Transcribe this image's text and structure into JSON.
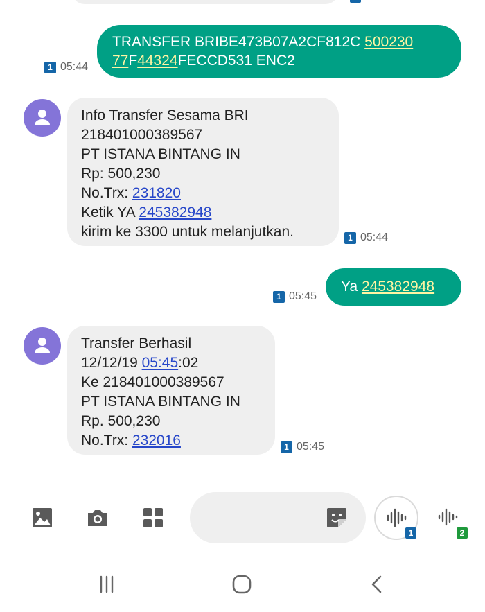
{
  "messages": [
    {
      "direction": "outgoing",
      "time": "05:44",
      "sim": "1",
      "lines": [
        [
          {
            "text": "TRANSFER BRIBE473B07A2CF812C "
          },
          {
            "text": "500230",
            "link": true
          }
        ],
        [
          {
            "text": "77",
            "link": true
          },
          {
            "text": "F"
          },
          {
            "text": "44324",
            "link": true
          },
          {
            "text": "FECCD531 ENC2"
          }
        ]
      ]
    },
    {
      "direction": "incoming",
      "time": "05:44",
      "sim": "1",
      "lines": [
        [
          {
            "text": "Info Transfer Sesama BRI"
          }
        ],
        [
          {
            "text": "218401000389567"
          }
        ],
        [
          {
            "text": "PT ISTANA BINTANG IN"
          }
        ],
        [
          {
            "text": "Rp: 500,230"
          }
        ],
        [
          {
            "text": "No.Trx: "
          },
          {
            "text": "231820",
            "link": true
          }
        ],
        [
          {
            "text": "Ketik YA "
          },
          {
            "text": "245382948",
            "link": true
          }
        ],
        [
          {
            "text": "kirim ke 3300 untuk melanjutkan."
          }
        ]
      ]
    },
    {
      "direction": "outgoing",
      "time": "05:45",
      "sim": "1",
      "lines": [
        [
          {
            "text": "Ya "
          },
          {
            "text": "245382948",
            "link": true
          }
        ]
      ]
    },
    {
      "direction": "incoming",
      "time": "05:45",
      "sim": "1",
      "lines": [
        [
          {
            "text": "Transfer Berhasil"
          }
        ],
        [
          {
            "text": "12/12/19 "
          },
          {
            "text": "05:45",
            "link": true
          },
          {
            "text": ":02"
          }
        ],
        [
          {
            "text": "Ke 218401000389567"
          }
        ],
        [
          {
            "text": "PT ISTANA BINTANG IN"
          }
        ],
        [
          {
            "text": "Rp. 500,230"
          }
        ],
        [
          {
            "text": "No.Trx: "
          },
          {
            "text": "232016",
            "link": true
          }
        ]
      ]
    }
  ],
  "composer": {
    "icons": [
      "image-icon",
      "camera-icon",
      "apps-grid-icon",
      "sticker-icon",
      "voice-send-icon"
    ],
    "send_sim1_badge": "1",
    "send_sim2_badge": "2"
  },
  "colors": {
    "outgoing_bubble": "#00a085",
    "incoming_bubble": "#efefef",
    "outgoing_link": "#fff4a3",
    "incoming_link": "#2747c9",
    "sim1_badge": "#1566a8",
    "sim2_badge": "#1f9a3c",
    "avatar": "#8474d8"
  },
  "navbar": {
    "icons": [
      "recents-icon",
      "home-icon",
      "back-icon"
    ]
  }
}
